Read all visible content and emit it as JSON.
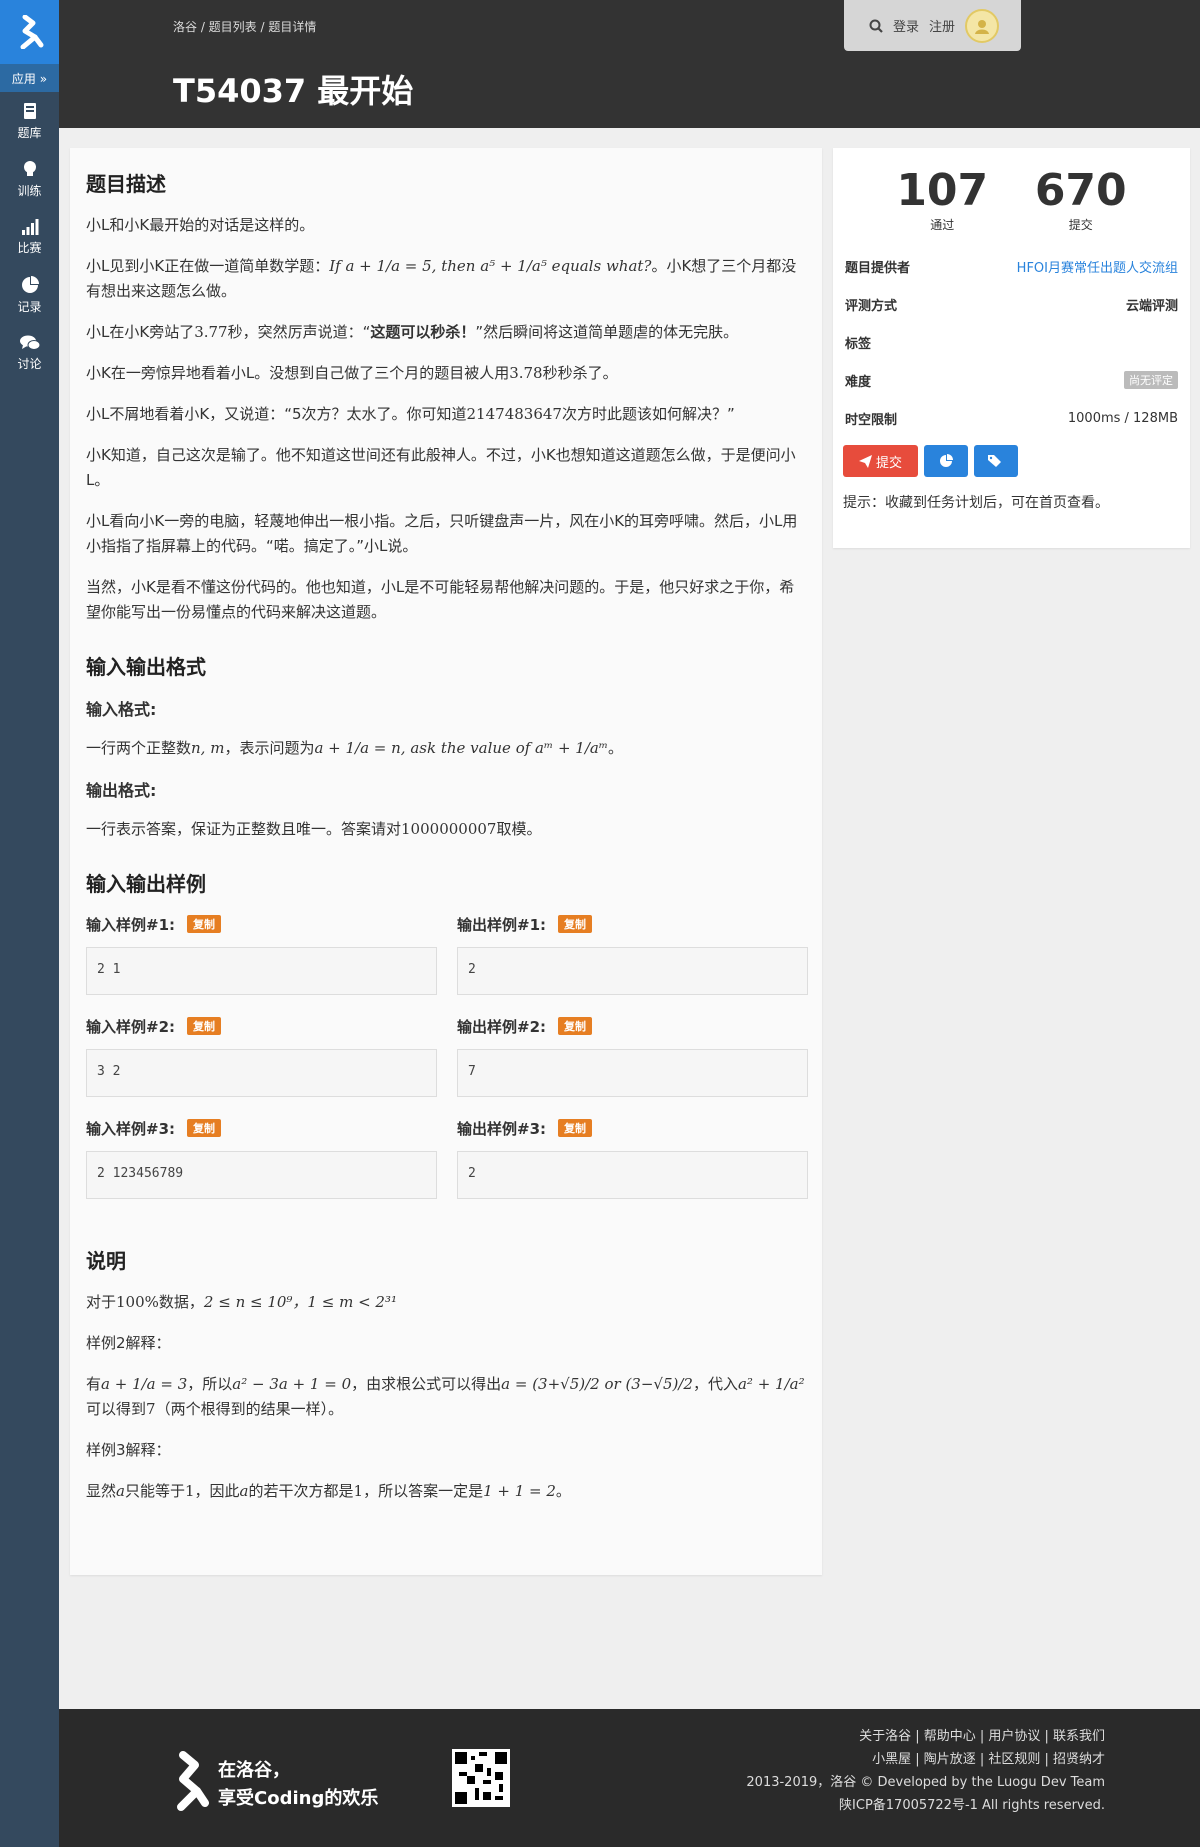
{
  "sidebar": {
    "apps_label": "应用 »",
    "items": [
      {
        "label": "题库",
        "icon": "book-icon"
      },
      {
        "label": "训练",
        "icon": "lightbulb-icon"
      },
      {
        "label": "比赛",
        "icon": "signal-bars-icon"
      },
      {
        "label": "记录",
        "icon": "pie-chart-icon"
      },
      {
        "label": "讨论",
        "icon": "comments-icon"
      }
    ]
  },
  "header": {
    "breadcrumb": "洛谷 / 题目列表 / 题目详情",
    "title": "T54037 最开始",
    "login": "登录",
    "register": "注册"
  },
  "problem": {
    "desc_title": "题目描述",
    "p1": "小L和小K最开始的对话是这样的。",
    "p2_a": "小L见到小K正在做一道简单数学题：",
    "p2_math": "If a + 1/a = 5, then a⁵ + 1/a⁵ equals what?",
    "p2_b": "。小K想了三个月都没有想出来这题怎么做。",
    "p3_a": "小L在小K旁站了",
    "p3_num": "3.77",
    "p3_b": "秒，突然厉声说道：“",
    "p3_bold": "这题可以秒杀！",
    "p3_c": "”然后瞬间将这道简单题虐的体无完肤。",
    "p4_a": "小K在一旁惊异地看着小L。没想到自己做了三个月的题目被人用",
    "p4_num": "3.78",
    "p4_b": "秒秒杀了。",
    "p5_a": "小L不屑地看着小K，又说道：“5次方？太水了。你可知道",
    "p5_num": "2147483647",
    "p5_b": "次方时此题该如何解决？”",
    "p6": "小K知道，自己这次是输了。他不知道这世间还有此般神人。不过，小K也想知道这道题怎么做，于是便问小L。",
    "p7": "小L看向小K一旁的电脑，轻蔑地伸出一根小指。之后，只听键盘声一片，风在小K的耳旁呼啸。然后，小L用小指指了指屏幕上的代码。“喏。搞定了。”小L说。",
    "p8": "当然，小K是看不懂这份代码的。他也知道，小L是不可能轻易帮他解决问题的。于是，他只好求之于你，希望你能写出一份易懂点的代码来解决这道题。",
    "io_title": "输入输出格式",
    "input_label": "输入格式:",
    "input_a": "一行两个正整数",
    "input_math1": "n, m",
    "input_b": "，表示问题为",
    "input_math2": "a + 1/a = n, ask the value of aᵐ + 1/aᵐ",
    "input_c": "。",
    "output_label": "输出格式:",
    "output_a": "一行表示答案，保证为正整数且唯一。答案请对",
    "output_num": "1000000007",
    "output_b": "取模。",
    "samples_title": "输入输出样例",
    "copy_label": "复制",
    "samples": [
      {
        "in_label": "输入样例#1:",
        "in": "2 1",
        "out_label": "输出样例#1:",
        "out": "2"
      },
      {
        "in_label": "输入样例#2:",
        "in": "3 2",
        "out_label": "输出样例#2:",
        "out": "7"
      },
      {
        "in_label": "输入样例#3:",
        "in": "2 123456789",
        "out_label": "输出样例#3:",
        "out": "2"
      }
    ],
    "notes_title": "说明",
    "n1_a": "对于",
    "n1_num": "100%",
    "n1_b": "数据，",
    "n1_math": "2 ≤ n ≤ 10⁹，1 ≤ m < 2³¹",
    "n2": "样例2解释：",
    "n3_a": "有",
    "n3_m1": "a + 1/a = 3",
    "n3_b": "，所以",
    "n3_m2": "a² − 3a + 1 = 0",
    "n3_c": "，由求根公式可以得出",
    "n3_m3": "a = (3+√5)/2 or (3−√5)/2",
    "n3_d": "，代入",
    "n3_m4": "a² + 1/a²",
    "n3_e": "可以得到",
    "n3_num": "7",
    "n3_f": "（两个根得到的结果一样）。",
    "n4": "样例3解释：",
    "n5_a": "显然",
    "n5_m1": "a",
    "n5_b": "只能等于",
    "n5_num": "1",
    "n5_c": "，因此",
    "n5_m2": "a",
    "n5_d": "的若干次方都是",
    "n5_num2": "1",
    "n5_e": "，所以答案一定是",
    "n5_m3": "1 + 1 = 2",
    "n5_f": "。"
  },
  "side": {
    "passed": "107",
    "passed_label": "通过",
    "submitted": "670",
    "submitted_label": "提交",
    "rows": [
      {
        "label": "题目提供者",
        "value": "HFOI月赛常任出题人交流组"
      },
      {
        "label": "评测方式",
        "value": "云端评测"
      },
      {
        "label": "标签",
        "value": ""
      },
      {
        "label": "难度",
        "value": "尚无评定"
      },
      {
        "label": "时空限制",
        "value": "1000ms / 128MB"
      }
    ],
    "submit_label": "提交",
    "tip": "提示：收藏到任务计划后，可在首页查看。"
  },
  "footer": {
    "slogan1": "在洛谷，",
    "slogan2": "享受Coding的欢乐",
    "links1": "关于洛谷 | 帮助中心 | 用户协议 | 联系我们",
    "links2": "小黑屋 | 陶片放逐 | 社区规则 | 招贤纳才",
    "copyright": "2013-2019，洛谷 © Developed by the Luogu Dev Team",
    "icp": "陕ICP备17005722号-1 All rights reserved."
  },
  "colors": {
    "accent": "#2983dc",
    "sidebar": "#34495e",
    "header": "#333333",
    "copy": "#e67e22",
    "submit": "#e74c3c"
  }
}
